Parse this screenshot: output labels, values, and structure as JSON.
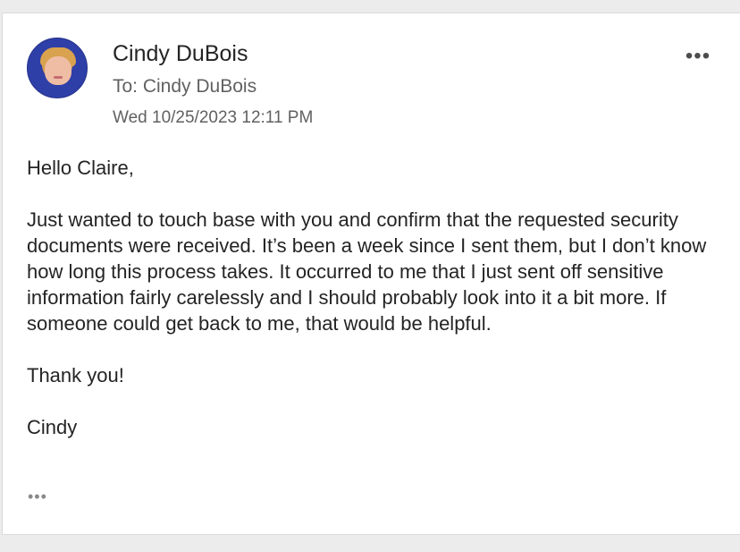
{
  "message": {
    "sender_name": "Cindy DuBois",
    "to_line": "To: Cindy DuBois",
    "datetime": "Wed 10/25/2023 12:11 PM",
    "more_actions_icon": "more-horizontal-icon",
    "expand_icon": "ellipsis-icon",
    "body": {
      "greeting": "Hello Claire,",
      "paragraph": "Just wanted to touch base with you and confirm that the requested security documents were received. It’s been a week since I sent them, but I don’t know how long this process takes. It occurred to me that I just sent off sensitive information fairly carelessly and I should probably look into it a bit more. If someone could get back to me, that would be helpful.",
      "closing": "Thank you!",
      "signature": "Cindy"
    }
  },
  "colors": {
    "background": "#ececec",
    "card": "#ffffff",
    "primary_text": "#242424",
    "secondary_text": "#616161"
  }
}
